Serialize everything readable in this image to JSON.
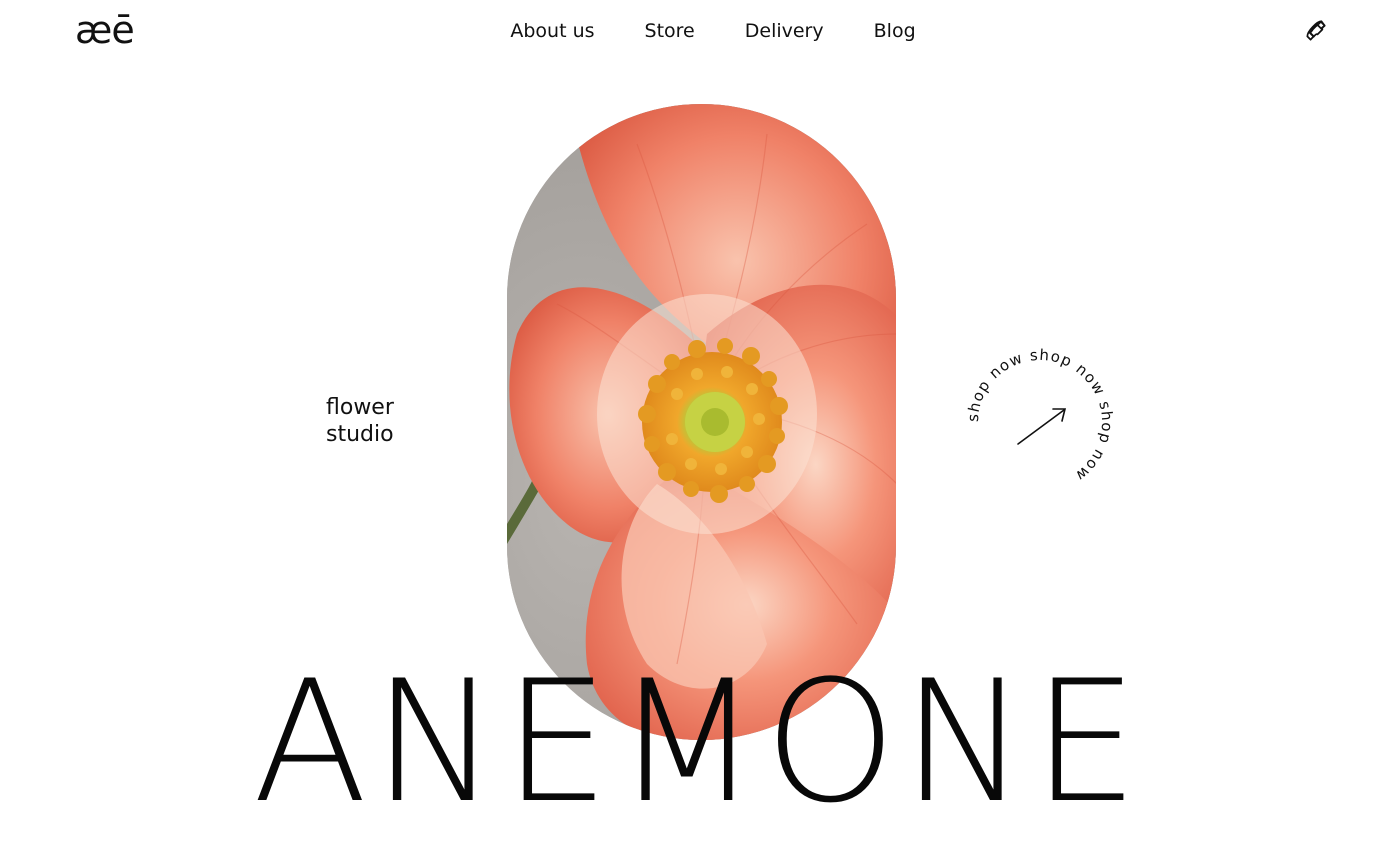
{
  "brand": {
    "logo_text": "æē"
  },
  "nav": {
    "items": [
      {
        "label": "About us"
      },
      {
        "label": "Store"
      },
      {
        "label": "Delivery"
      },
      {
        "label": "Blog"
      }
    ]
  },
  "header": {
    "phone_icon": "phone-icon"
  },
  "hero": {
    "tagline_line1": "flower",
    "tagline_line2": "studio",
    "headline": "ANEMONE",
    "badge_text": "shop now shop now shop now ",
    "badge_icon": "arrow-up-right-icon",
    "image_subject": "coral poppy flower"
  },
  "colors": {
    "background": "#ffffff",
    "text": "#111111",
    "petal": "#f07a5f",
    "stamen": "#e8a21f",
    "backdrop": "#a9a6a2"
  }
}
